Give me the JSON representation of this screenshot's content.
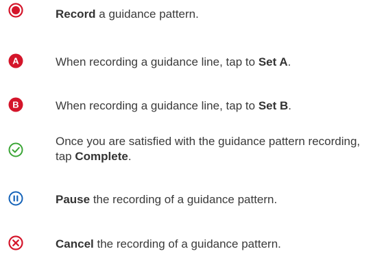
{
  "colors": {
    "red": "#d4152a",
    "green": "#3aa535",
    "blue": "#1462b8",
    "text": "#3a3a3a"
  },
  "items": [
    {
      "icon": "record-icon",
      "bold": "Record",
      "rest": " a guidance pattern.",
      "before": ""
    },
    {
      "icon": "set-a-icon",
      "glyph": "A",
      "before": "When recording a guidance line, tap to ",
      "bold": "Set A",
      "rest": "."
    },
    {
      "icon": "set-b-icon",
      "glyph": "B",
      "before": "When recording a guidance line, tap to ",
      "bold": "Set B",
      "rest": "."
    },
    {
      "icon": "complete-icon",
      "before": "Once you are satisfied with the guidance pattern recording, tap ",
      "bold": "Complete",
      "rest": "."
    },
    {
      "icon": "pause-icon",
      "before": "",
      "bold": "Pause",
      "rest": " the recording of a guidance pattern."
    },
    {
      "icon": "cancel-icon",
      "before": "",
      "bold": "Cancel",
      "rest": " the recording of a guidance pattern."
    }
  ]
}
